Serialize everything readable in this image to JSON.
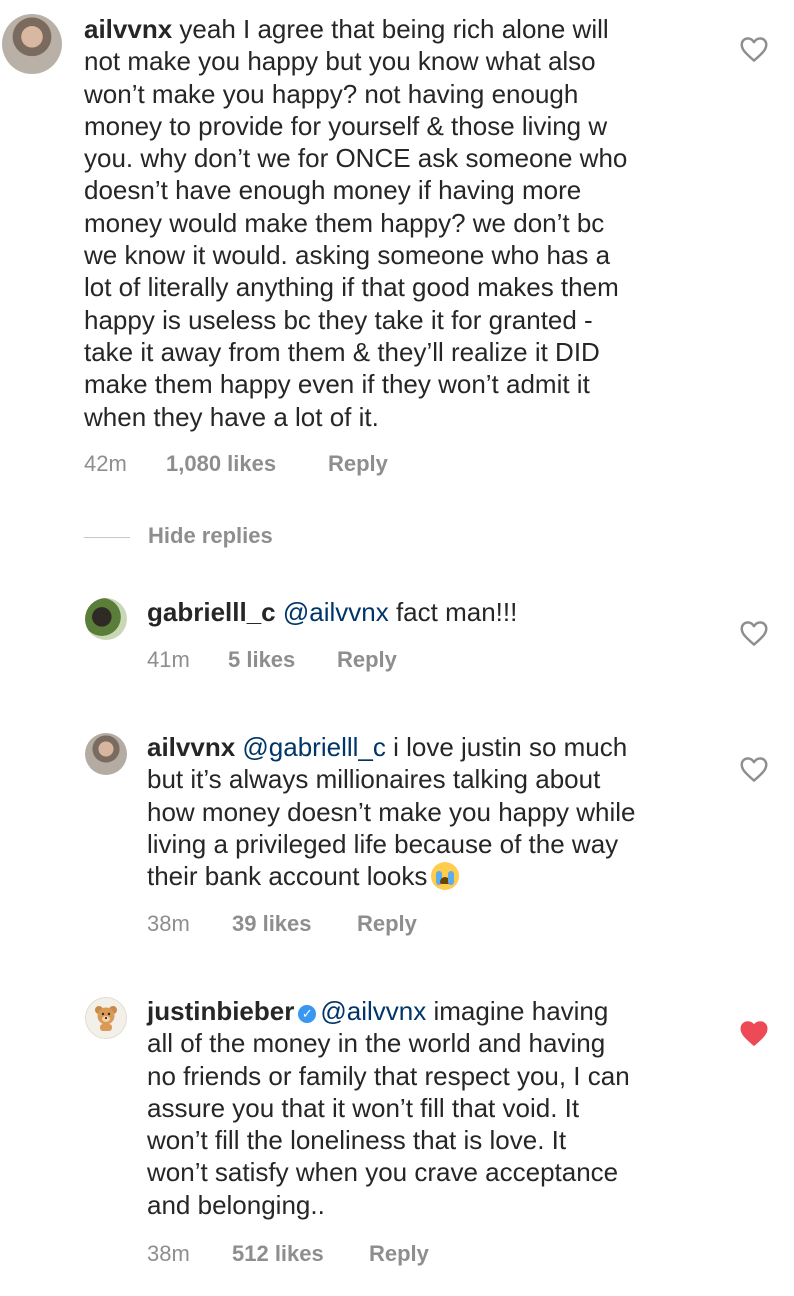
{
  "comments": [
    {
      "username": "ailvvnx",
      "lines": [
        " yeah I agree that being rich alone will",
        "not make you happy but you know what also",
        "won’t make you happy? not having enough",
        "money to provide for yourself & those living w",
        "you. why don’t we for ONCE ask someone who",
        "doesn’t have enough money if having more",
        "money would make them happy? we don’t bc",
        "we know it would. asking someone who has a",
        "lot of literally anything if that good makes them",
        "happy is useless bc they take it for granted -",
        "take it away from them & they’ll realize it DID",
        "make them happy even if they won’t admit it",
        "when they have a lot of it."
      ],
      "time": "42m",
      "likes": "1,080 likes",
      "reply": "Reply",
      "liked": false
    }
  ],
  "hide_replies": "Hide replies",
  "replies": [
    {
      "username": "gabrielll_c",
      "mention": "@ailvvnx",
      "lines": [
        " fact man!!!"
      ],
      "time": "41m",
      "likes": "5 likes",
      "reply": "Reply",
      "liked": false
    },
    {
      "username": "ailvvnx",
      "mention": "@gabrielll_c",
      "lines": [
        " i love justin so much",
        "but it’s always millionaires talking about",
        "how money doesn’t make you happy while",
        "living a privileged life because of the way",
        "their bank account looks"
      ],
      "emoji": "loudly-crying-face",
      "time": "38m",
      "likes": "39 likes",
      "reply": "Reply",
      "liked": false
    },
    {
      "username": "justinbieber",
      "verified": true,
      "mention": "@ailvvnx",
      "lines": [
        " imagine having",
        "all of the money in the world and having",
        "no friends or family that respect you, I can",
        "assure you that it won’t fill that void. It",
        "won’t fill the loneliness that is love. It",
        "won’t satisfy when you crave acceptance",
        "and belonging.."
      ],
      "time": "38m",
      "likes": "512 likes",
      "reply": "Reply",
      "liked": true
    }
  ],
  "colors": {
    "text": "#262626",
    "meta": "#8e8e8e",
    "mention": "#003569",
    "heart_liked": "#ed4956",
    "verified": "#3897f0"
  },
  "icons": {
    "like": "heart-outline-icon",
    "liked": "heart-filled-icon",
    "verified": "verified-badge-icon"
  }
}
